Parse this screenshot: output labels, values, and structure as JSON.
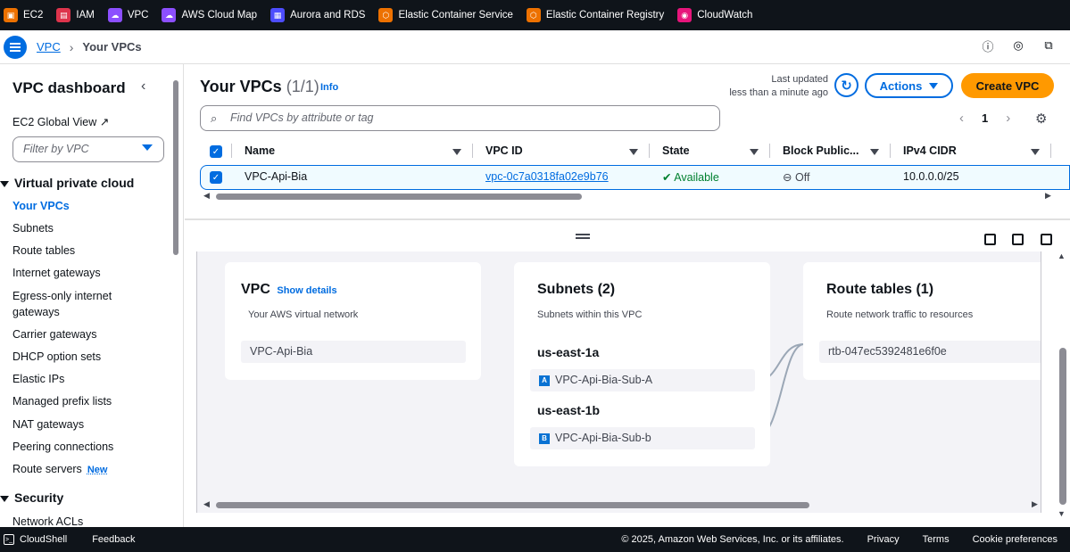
{
  "top_nav": {
    "services": [
      {
        "label": "EC2",
        "icon": "ec2-icon",
        "color": "#ed7100"
      },
      {
        "label": "IAM",
        "icon": "iam-icon",
        "color": "#dd344c"
      },
      {
        "label": "VPC",
        "icon": "vpc-icon",
        "color": "#8c4fff"
      },
      {
        "label": "AWS Cloud Map",
        "icon": "cloud-map-icon",
        "color": "#8c4fff"
      },
      {
        "label": "Aurora and RDS",
        "icon": "rds-icon",
        "color": "#4d4dff"
      },
      {
        "label": "Elastic Container Service",
        "icon": "ecs-icon",
        "color": "#ed7100"
      },
      {
        "label": "Elastic Container Registry",
        "icon": "ecr-icon",
        "color": "#ed7100"
      },
      {
        "label": "CloudWatch",
        "icon": "cloudwatch-icon",
        "color": "#e7157b"
      }
    ]
  },
  "breadcrumb": {
    "root": "VPC",
    "current": "Your VPCs"
  },
  "sidebar": {
    "title": "VPC dashboard",
    "ec2_global_view": "EC2 Global View",
    "filter_placeholder": "Filter by VPC",
    "section_vpc": "Virtual private cloud",
    "items": [
      "Your VPCs",
      "Subnets",
      "Route tables",
      "Internet gateways",
      "Egress-only internet gateways",
      "Carrier gateways",
      "DHCP option sets",
      "Elastic IPs",
      "Managed prefix lists",
      "NAT gateways",
      "Peering connections",
      "Route servers"
    ],
    "new_badge": "New",
    "section_security": "Security",
    "security_items": [
      "Network ACLs"
    ]
  },
  "main": {
    "title": "Your VPCs",
    "count": "(1/1)",
    "info": "Info",
    "last_updated_label": "Last updated",
    "last_updated_value": "less than a minute ago",
    "actions_label": "Actions",
    "create_label": "Create VPC",
    "search_placeholder": "Find VPCs by attribute or tag",
    "page": "1",
    "columns": [
      "Name",
      "VPC ID",
      "State",
      "Block Public...",
      "IPv4 CIDR"
    ],
    "rows": [
      {
        "name": "VPC-Api-Bia",
        "vpc_id": "vpc-0c7a0318fa02e9b76",
        "state": "Available",
        "block_public": "Off",
        "ipv4_cidr": "10.0.0.0/25"
      }
    ]
  },
  "resource_map": {
    "vpc_card": {
      "title": "VPC",
      "show_details": "Show details",
      "subtitle": "Your AWS virtual network",
      "name": "VPC-Api-Bia"
    },
    "subnets_card": {
      "title": "Subnets (2)",
      "subtitle": "Subnets within this VPC",
      "zones": [
        {
          "zone": "us-east-1a",
          "label": "A",
          "subnet": "VPC-Api-Bia-Sub-A"
        },
        {
          "zone": "us-east-1b",
          "label": "B",
          "subnet": "VPC-Api-Bia-Sub-b"
        }
      ]
    },
    "route_tables_card": {
      "title": "Route tables (1)",
      "subtitle": "Route network traffic to resources",
      "route_table": "rtb-047ec5392481e6f0e"
    }
  },
  "footer": {
    "cloudshell": "CloudShell",
    "feedback": "Feedback",
    "copyright": "© 2025, Amazon Web Services, Inc. or its affiliates.",
    "privacy": "Privacy",
    "terms": "Terms",
    "cookies": "Cookie preferences"
  },
  "colors": {
    "accent": "#006ce0",
    "primary_button": "#ff9900",
    "nav_bg": "#0f141a",
    "available": "#00802f"
  }
}
